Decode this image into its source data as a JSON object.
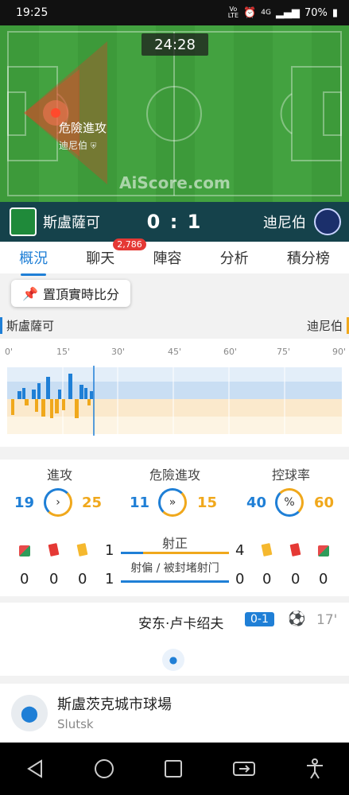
{
  "status_bar": {
    "time": "19:25",
    "battery": "70%",
    "network": "4G",
    "lte_top": "Vo",
    "lte_bottom": "LTE"
  },
  "match": {
    "clock": "24:28",
    "watermark": "AiScore.com",
    "current_event": {
      "title": "危險進攻",
      "team": "迪尼伯"
    },
    "home_team": "斯盧薩可",
    "away_team": "迪尼伯",
    "score": "0 : 1"
  },
  "tabs": [
    {
      "label": "概況",
      "active": true
    },
    {
      "label": "聊天",
      "badge": "2,786"
    },
    {
      "label": "陣容"
    },
    {
      "label": "分析"
    },
    {
      "label": "積分榜"
    }
  ],
  "pin_button": {
    "label": "置頂實時比分"
  },
  "timeline": {
    "home_label": "斯盧薩可",
    "away_label": "迪尼伯",
    "ticks": [
      "0'",
      "15'",
      "30'",
      "45'",
      "60'",
      "75'",
      "90'"
    ],
    "home_color": "#1f7fd6",
    "away_color": "#f0a81c"
  },
  "stats": {
    "attacks": {
      "label": "進攻",
      "home": "19",
      "away": "25"
    },
    "dangerous_attacks": {
      "label": "危險進攻",
      "home": "11",
      "away": "15"
    },
    "possession": {
      "label": "控球率",
      "home": "40",
      "away": "60"
    },
    "home_cards": {
      "corners": "0",
      "red": "0",
      "yellow": "0"
    },
    "away_cards": {
      "corners": "0",
      "red": "0",
      "yellow": "0"
    },
    "shots_on_target": {
      "label": "射正",
      "home": "1",
      "away": "4"
    },
    "shots_off": {
      "label": "射偏 / 被封堵射门",
      "home": "1",
      "away": "0"
    }
  },
  "goal_event": {
    "player": "安东·卢卡绍夫",
    "score": "0-1",
    "minute": "17'"
  },
  "venue": {
    "name": "斯盧茨克城市球場",
    "city": "Slutsk"
  }
}
